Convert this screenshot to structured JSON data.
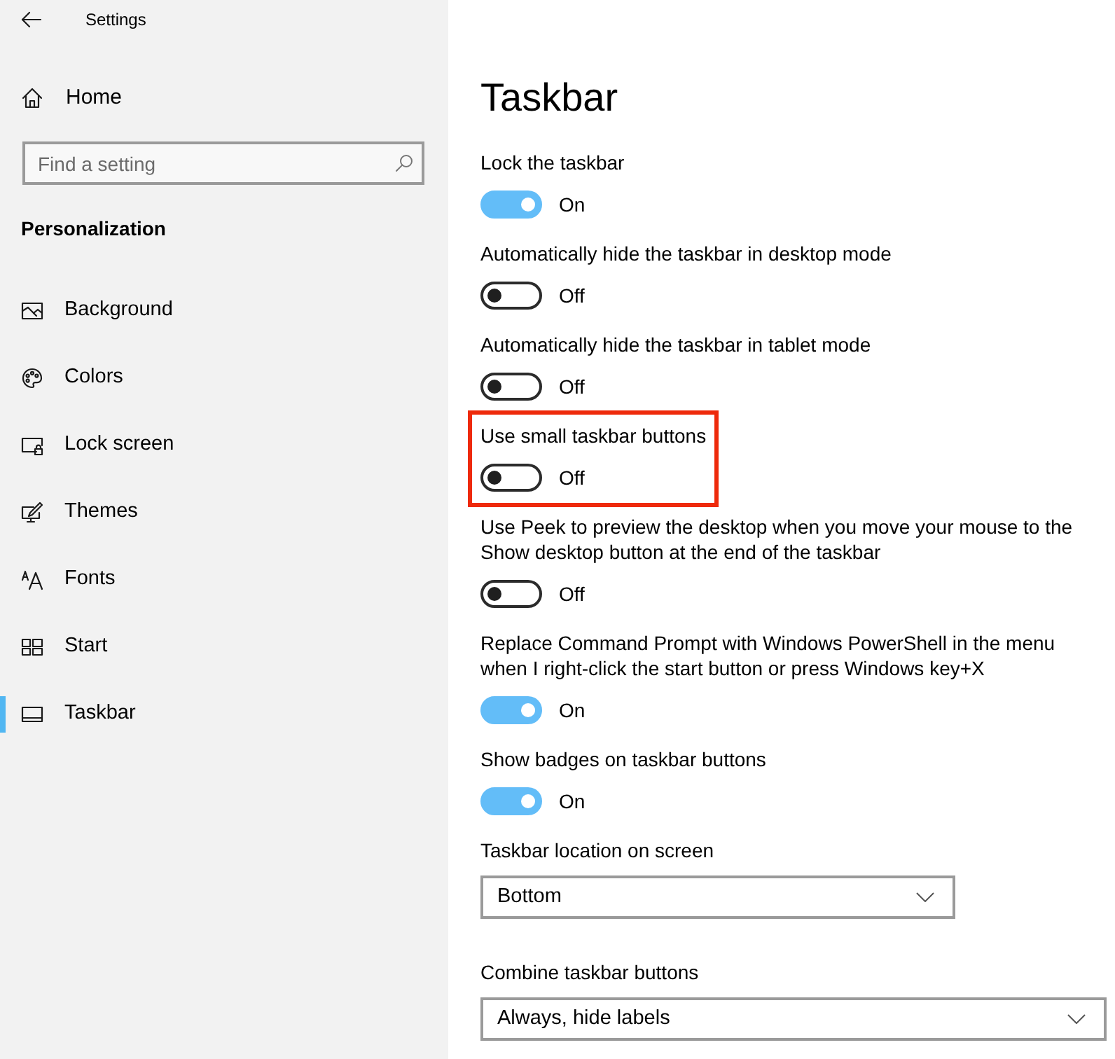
{
  "window": {
    "title": "Settings"
  },
  "sidebar": {
    "home": "Home",
    "search": {
      "placeholder": "Find a setting"
    },
    "section_title": "Personalization",
    "items": [
      {
        "label": "Background",
        "selected": false
      },
      {
        "label": "Colors",
        "selected": false
      },
      {
        "label": "Lock screen",
        "selected": false
      },
      {
        "label": "Themes",
        "selected": false
      },
      {
        "label": "Fonts",
        "selected": false
      },
      {
        "label": "Start",
        "selected": false
      },
      {
        "label": "Taskbar",
        "selected": true
      }
    ]
  },
  "main": {
    "title": "Taskbar",
    "settings": [
      {
        "kind": "toggle",
        "label": "Lock the taskbar",
        "on": true,
        "state_text": "On",
        "highlighted": false
      },
      {
        "kind": "toggle",
        "label": "Automatically hide the taskbar in desktop mode",
        "on": false,
        "state_text": "Off",
        "highlighted": false
      },
      {
        "kind": "toggle",
        "label": "Automatically hide the taskbar in tablet mode",
        "on": false,
        "state_text": "Off",
        "highlighted": false
      },
      {
        "kind": "toggle",
        "label": "Use small taskbar buttons",
        "on": false,
        "state_text": "Off",
        "highlighted": true
      },
      {
        "kind": "toggle",
        "label": "Use Peek to preview the desktop when you move your mouse to the Show desktop button at the end of the taskbar",
        "on": false,
        "state_text": "Off",
        "highlighted": false
      },
      {
        "kind": "toggle",
        "label": "Replace Command Prompt with Windows PowerShell in the menu when I right-click the start button or press Windows key+X",
        "on": true,
        "state_text": "On",
        "highlighted": false
      },
      {
        "kind": "toggle",
        "label": "Show badges on taskbar buttons",
        "on": true,
        "state_text": "On",
        "highlighted": false
      },
      {
        "kind": "dropdown",
        "label": "Taskbar location on screen",
        "value": "Bottom",
        "highlighted": false
      },
      {
        "kind": "dropdown",
        "label": "Combine taskbar buttons",
        "value": "Always, hide labels",
        "highlighted": false
      }
    ]
  }
}
